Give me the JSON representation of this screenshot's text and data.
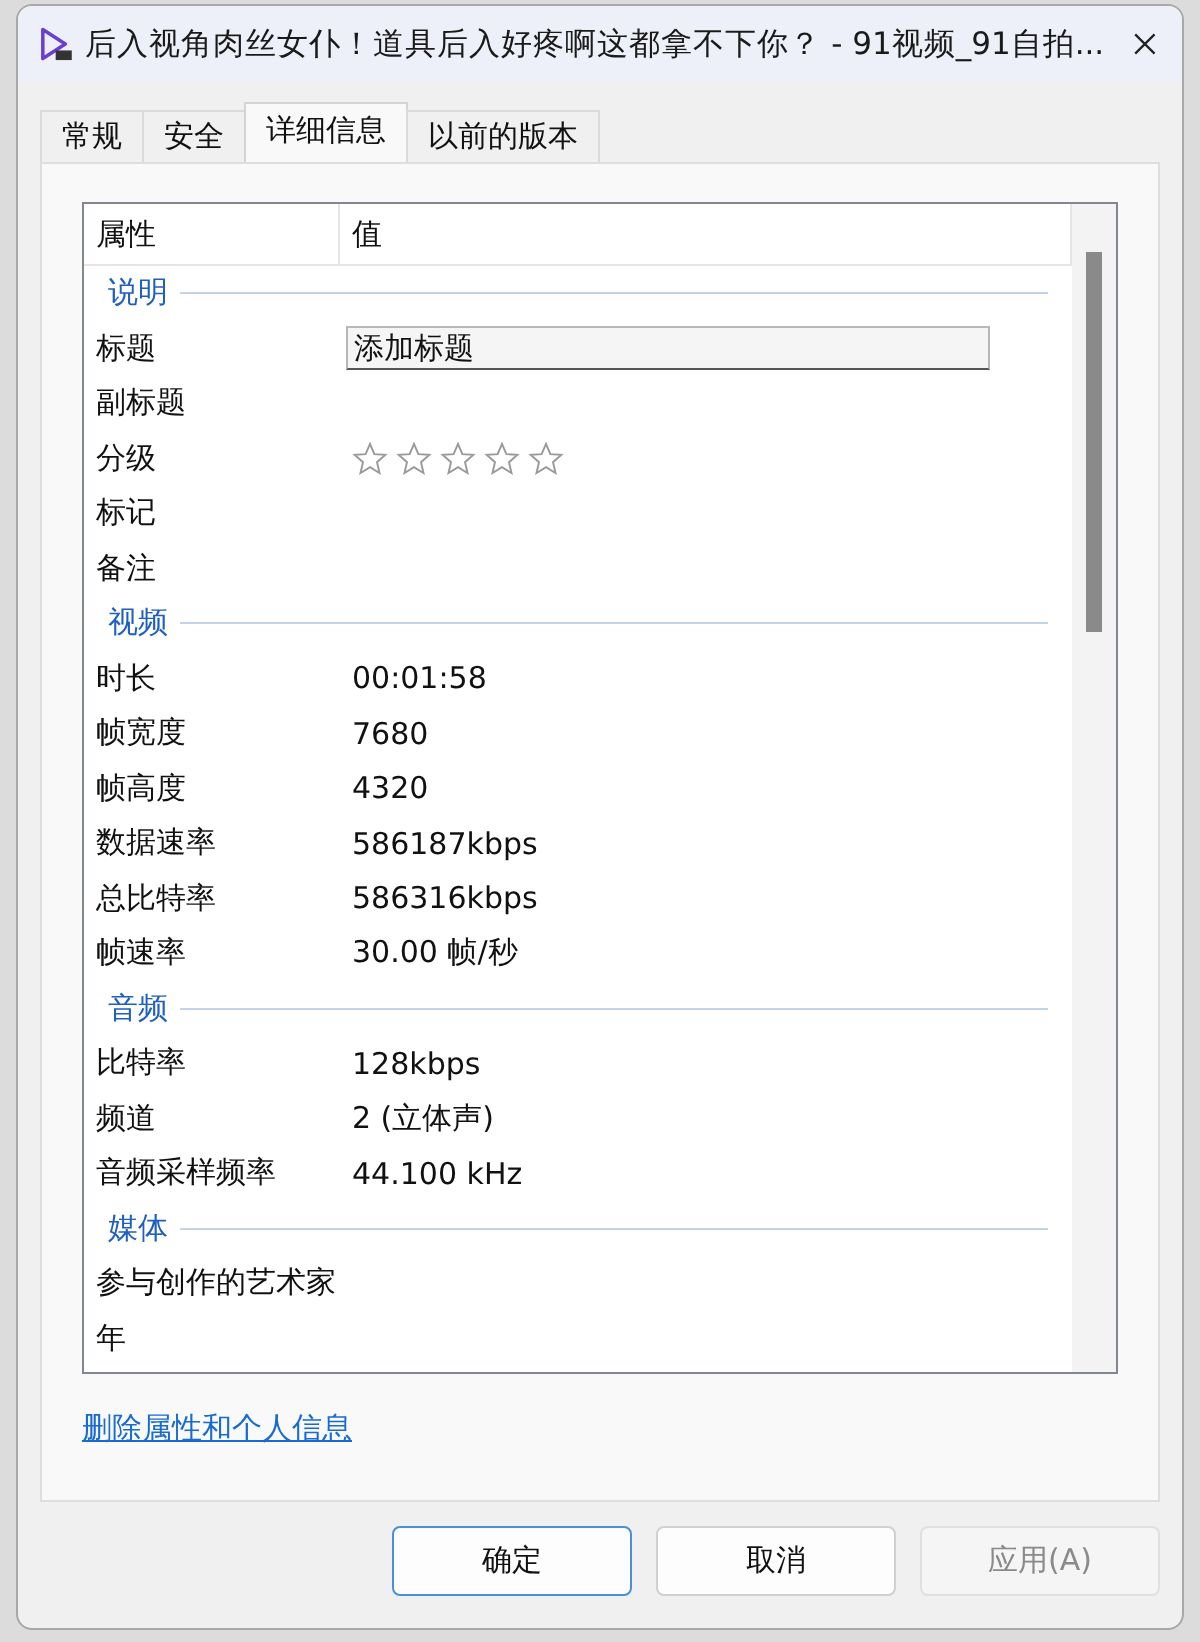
{
  "window": {
    "title": "后入视角肉丝女仆！道具后入好疼啊这都拿不下你？ - 91视频_91自拍..."
  },
  "tabs": [
    {
      "label": "常规",
      "selected": false
    },
    {
      "label": "安全",
      "selected": false
    },
    {
      "label": "详细信息",
      "selected": true
    },
    {
      "label": "以前的版本",
      "selected": false
    }
  ],
  "details": {
    "columns": [
      "属性",
      "值"
    ],
    "rows": [
      {
        "kind": "section",
        "label": "说明"
      },
      {
        "kind": "field",
        "name": "标题",
        "placeholder": "添加标题"
      },
      {
        "kind": "text",
        "name": "副标题"
      },
      {
        "kind": "stars",
        "name": "分级",
        "stars": 0
      },
      {
        "kind": "text",
        "name": "标记"
      },
      {
        "kind": "text",
        "name": "备注"
      },
      {
        "kind": "section",
        "label": "视频"
      },
      {
        "kind": "text",
        "name": "时长",
        "value": "00:01:58"
      },
      {
        "kind": "text",
        "name": "帧宽度",
        "value": "7680"
      },
      {
        "kind": "text",
        "name": "帧高度",
        "value": "4320"
      },
      {
        "kind": "text",
        "name": "数据速率",
        "value": "586187kbps"
      },
      {
        "kind": "text",
        "name": "总比特率",
        "value": "586316kbps"
      },
      {
        "kind": "text",
        "name": "帧速率",
        "value": "30.00 帧/秒"
      },
      {
        "kind": "section",
        "label": "音频"
      },
      {
        "kind": "text",
        "name": "比特率",
        "value": "128kbps"
      },
      {
        "kind": "text",
        "name": "频道",
        "value": "2 (立体声)"
      },
      {
        "kind": "text",
        "name": "音频采样频率",
        "value": "44.100 kHz"
      },
      {
        "kind": "section",
        "label": "媒体"
      },
      {
        "kind": "text",
        "name": "参与创作的艺术家"
      },
      {
        "kind": "text",
        "name": "年"
      }
    ]
  },
  "link": "删除属性和个人信息",
  "buttons": [
    {
      "label": "确定",
      "kind": "default",
      "disabled": false
    },
    {
      "label": "取消",
      "kind": "normal",
      "disabled": false
    },
    {
      "label": "应用(A)",
      "kind": "normal",
      "disabled": true
    }
  ]
}
